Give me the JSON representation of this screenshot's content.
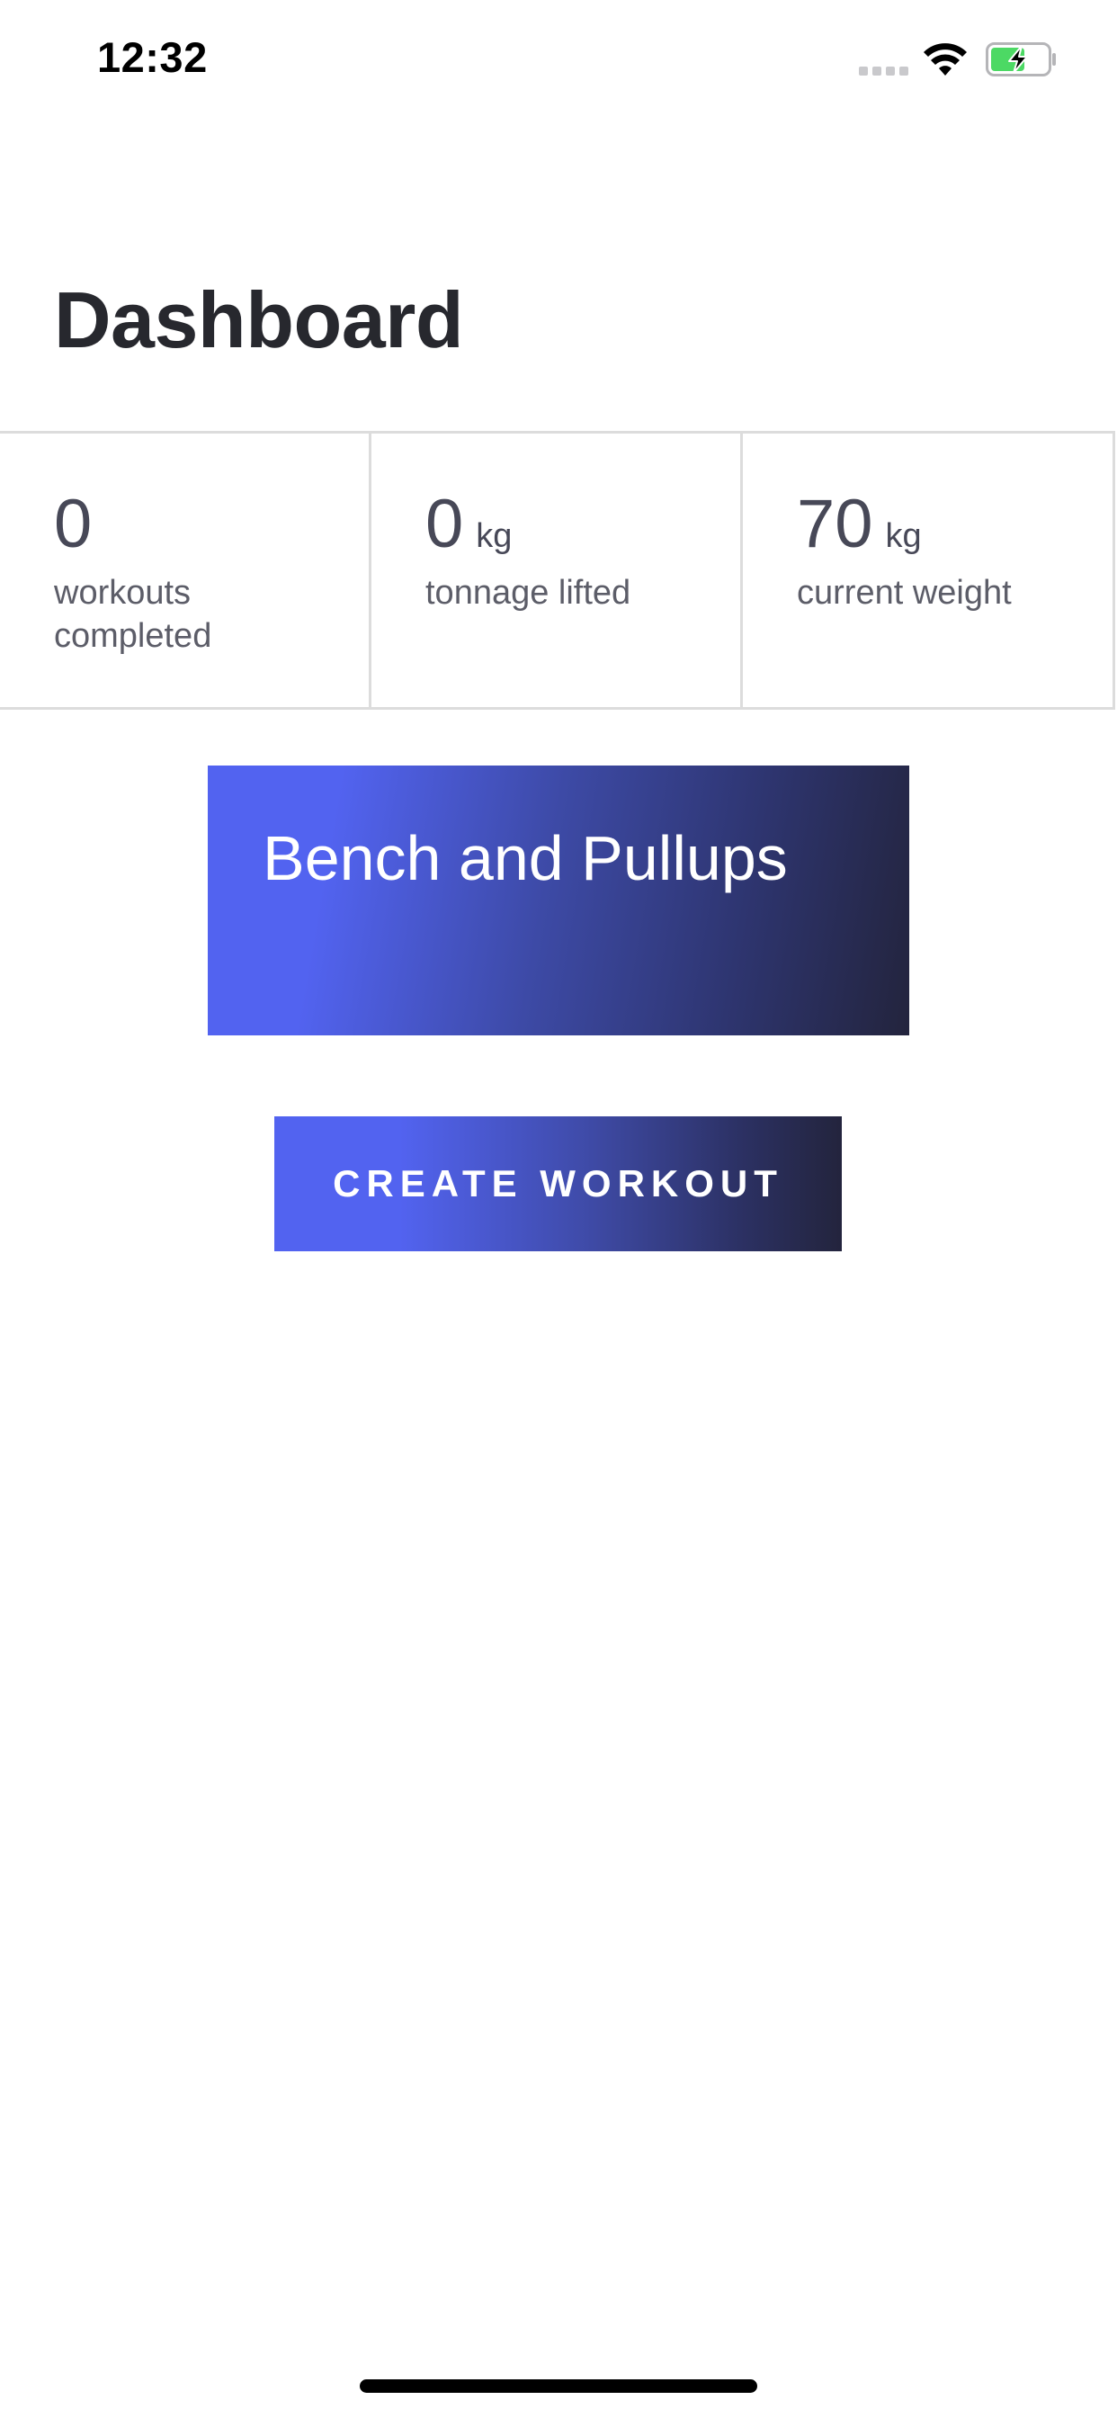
{
  "status_bar": {
    "time": "12:32",
    "icons": [
      "signal-icon",
      "wifi-icon",
      "battery-charging-icon"
    ]
  },
  "header": {
    "title": "Dashboard"
  },
  "stats": [
    {
      "value": "0",
      "unit": "",
      "label": "workouts completed"
    },
    {
      "value": "0",
      "unit": "kg",
      "label": "tonnage lifted"
    },
    {
      "value": "70",
      "unit": "kg",
      "label": "current weight"
    }
  ],
  "workouts": [
    {
      "title": "Bench and Pullups"
    }
  ],
  "actions": {
    "create_workout_label": "CREATE WORKOUT"
  },
  "colors": {
    "accent_start": "#5263f0",
    "accent_end": "#23243d",
    "battery_green": "#4cd964"
  }
}
